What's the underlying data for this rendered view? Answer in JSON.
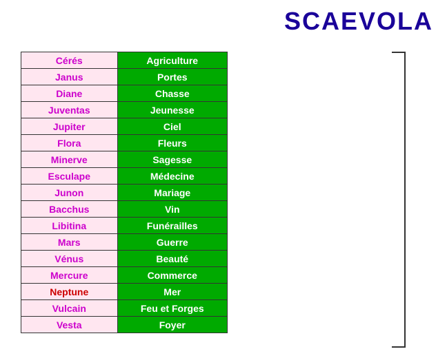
{
  "title": "SCAEVOLA",
  "rows": [
    {
      "name": "Cérés",
      "domain": "Agriculture",
      "nameClass": "col-name"
    },
    {
      "name": "Janus",
      "domain": "Portes",
      "nameClass": "col-name"
    },
    {
      "name": "Diane",
      "domain": "Chasse",
      "nameClass": "col-name"
    },
    {
      "name": "Juventas",
      "domain": "Jeunesse",
      "nameClass": "col-name"
    },
    {
      "name": "Jupiter",
      "domain": "Ciel",
      "nameClass": "col-name"
    },
    {
      "name": "Flora",
      "domain": "Fleurs",
      "nameClass": "col-name"
    },
    {
      "name": "Minerve",
      "domain": "Sagesse",
      "nameClass": "col-name"
    },
    {
      "name": "Esculape",
      "domain": "Médecine",
      "nameClass": "col-name"
    },
    {
      "name": "Junon",
      "domain": "Mariage",
      "nameClass": "col-name"
    },
    {
      "name": "Bacchus",
      "domain": "Vin",
      "nameClass": "col-name"
    },
    {
      "name": "Libitina",
      "domain": "Funérailles",
      "nameClass": "col-name"
    },
    {
      "name": "Mars",
      "domain": "Guerre",
      "nameClass": "col-name"
    },
    {
      "name": "Vénus",
      "domain": "Beauté",
      "nameClass": "col-name"
    },
    {
      "name": "Mercure",
      "domain": "Commerce",
      "nameClass": "col-name"
    },
    {
      "name": "Neptune",
      "domain": "Mer",
      "nameClass": "col-name red"
    },
    {
      "name": "Vulcain",
      "domain": "Feu et Forges",
      "nameClass": "col-name"
    },
    {
      "name": "Vesta",
      "domain": "Foyer",
      "nameClass": "col-name"
    }
  ]
}
